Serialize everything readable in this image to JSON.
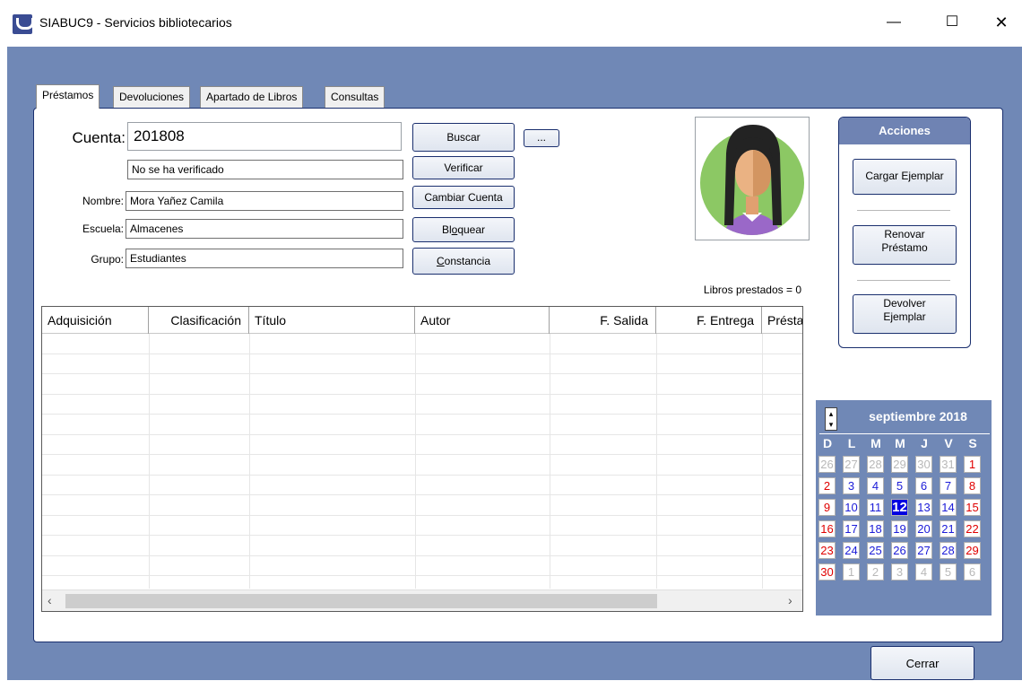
{
  "window": {
    "title": "SIABUC9 - Servicios bibliotecarios",
    "min_glyph": "—",
    "max_glyph": "☐",
    "close_glyph": "✕"
  },
  "tabs": [
    {
      "label": "Préstamos"
    },
    {
      "label": "Devoluciones"
    },
    {
      "label": "Apartado de Libros"
    },
    {
      "label": "Consultas"
    }
  ],
  "form": {
    "cuenta_label": "Cuenta:",
    "cuenta_value": "201808",
    "status_value": "No se ha verificado",
    "nombre_label": "Nombre:",
    "nombre_value": "Mora Yañez Camila",
    "escuela_label": "Escuela:",
    "escuela_value": "Almacenes",
    "grupo_label": "Grupo:",
    "grupo_value": "Estudiantes"
  },
  "buttons": {
    "buscar": "Buscar",
    "more": "...",
    "verificar": "Verificar",
    "cambiar_cuenta": "Cambiar Cuenta",
    "bloquear_pre": "Bl",
    "bloquear_u": "o",
    "bloquear_post": "quear",
    "constancia_u": "C",
    "constancia_post": "onstancia",
    "cerrar": "Cerrar"
  },
  "libros_prestados": "Libros prestados = 0",
  "acciones": {
    "title": "Acciones",
    "cargar": "Cargar Ejemplar",
    "renovar_1": "Renovar",
    "renovar_2": "Préstamo",
    "devolver_1": "Devolver",
    "devolver_2": "Ejemplar"
  },
  "table": {
    "columns": [
      "Adquisición",
      "Clasificación",
      "Título",
      "Autor",
      "F. Salida",
      "F. Entrega",
      "Présta"
    ],
    "rows": []
  },
  "calendar": {
    "month": "septiembre 2018",
    "dow": [
      "D",
      "L",
      "M",
      "M",
      "J",
      "V",
      "S"
    ],
    "weeks": [
      [
        "26",
        "27",
        "28",
        "29",
        "30",
        "31",
        "1"
      ],
      [
        "2",
        "3",
        "4",
        "5",
        "6",
        "7",
        "8"
      ],
      [
        "9",
        "10",
        "11",
        "12",
        "13",
        "14",
        "15"
      ],
      [
        "16",
        "17",
        "18",
        "19",
        "20",
        "21",
        "22"
      ],
      [
        "23",
        "24",
        "25",
        "26",
        "27",
        "28",
        "29"
      ],
      [
        "30",
        "1",
        "2",
        "3",
        "4",
        "5",
        "6"
      ]
    ],
    "selected_day": "12"
  },
  "colors": {
    "background_blue": "#7088b6",
    "frame_navy": "#1a2f6e",
    "weekend_red": "#e00000",
    "weekday_blue": "#1c1cd8",
    "today_blue": "#0000e0"
  }
}
